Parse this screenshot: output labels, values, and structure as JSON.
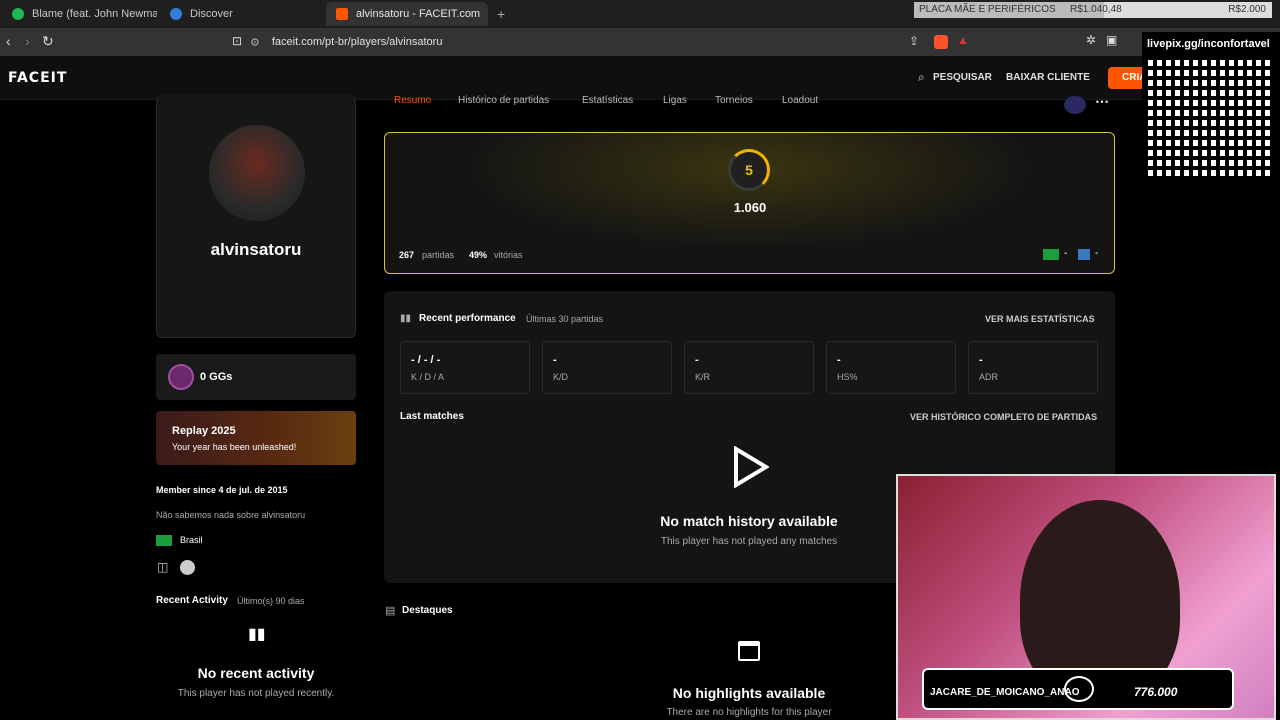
{
  "browser": {
    "tabs": [
      {
        "label": "Blame (feat. John Newman) • Cal"
      },
      {
        "label": "Discover"
      },
      {
        "label": "alvinsatoru - FACEIT.com"
      }
    ],
    "url": "faceit.com/pt-br/players/alvinsatoru"
  },
  "overlay": {
    "price_label": "PLACA MÃE E PERIFÉRICOS",
    "price_current": "R$1.040,48",
    "price_goal": "R$2.000",
    "qr_label": "livepix.gg/inconfortavel",
    "badge_left": "JACARE_DE_MOICANO_ANAO",
    "badge_right": "776.000"
  },
  "header": {
    "logo": "FACEIT",
    "search": "PESQUISAR",
    "download": "BAIXAR CLIENTE",
    "create": "CRIA"
  },
  "profile": {
    "username": "alvinsatoru",
    "gg": "0 GGs",
    "replay_title": "Replay 2025",
    "replay_sub": "Your year has been unleashed!",
    "member_since": "Member since 4 de jul. de 2015",
    "bio": "Não sabemos nada sobre alvinsatoru",
    "country": "Brasil",
    "recent_activity_title": "Recent Activity",
    "recent_activity_period": "Último(s) 90 dias",
    "no_recent": "No recent activity",
    "no_recent_sub": "This player has not played recently."
  },
  "tabs": [
    "Resumo",
    "Histórico de partidas",
    "Estatísticas",
    "Ligas",
    "Torneios",
    "Loadout"
  ],
  "elo": {
    "level": "5",
    "value": "1.060",
    "matches_num": "267",
    "matches_label": "partidas",
    "wins_num": "49%",
    "wins_label": "vitórias",
    "flag1_val": "-",
    "flag2_val": "-"
  },
  "performance": {
    "title": "Recent performance",
    "subtitle": "Últimas 30 partidas",
    "more": "VER MAIS ESTATÍSTICAS",
    "stats": [
      {
        "value": "- / - / -",
        "label": "K / D / A"
      },
      {
        "value": "-",
        "label": "K/D"
      },
      {
        "value": "-",
        "label": "K/R"
      },
      {
        "value": "-",
        "label": "HS%"
      },
      {
        "value": "-",
        "label": "ADR"
      }
    ],
    "last_matches": "Last matches",
    "full_history": "VER HISTÓRICO COMPLETO DE PARTIDAS",
    "no_history": "No match history available",
    "no_history_sub": "This player has not played any matches"
  },
  "highlights": {
    "title": "Destaques",
    "none": "No highlights available",
    "none_sub": "There are no highlights for this player"
  }
}
